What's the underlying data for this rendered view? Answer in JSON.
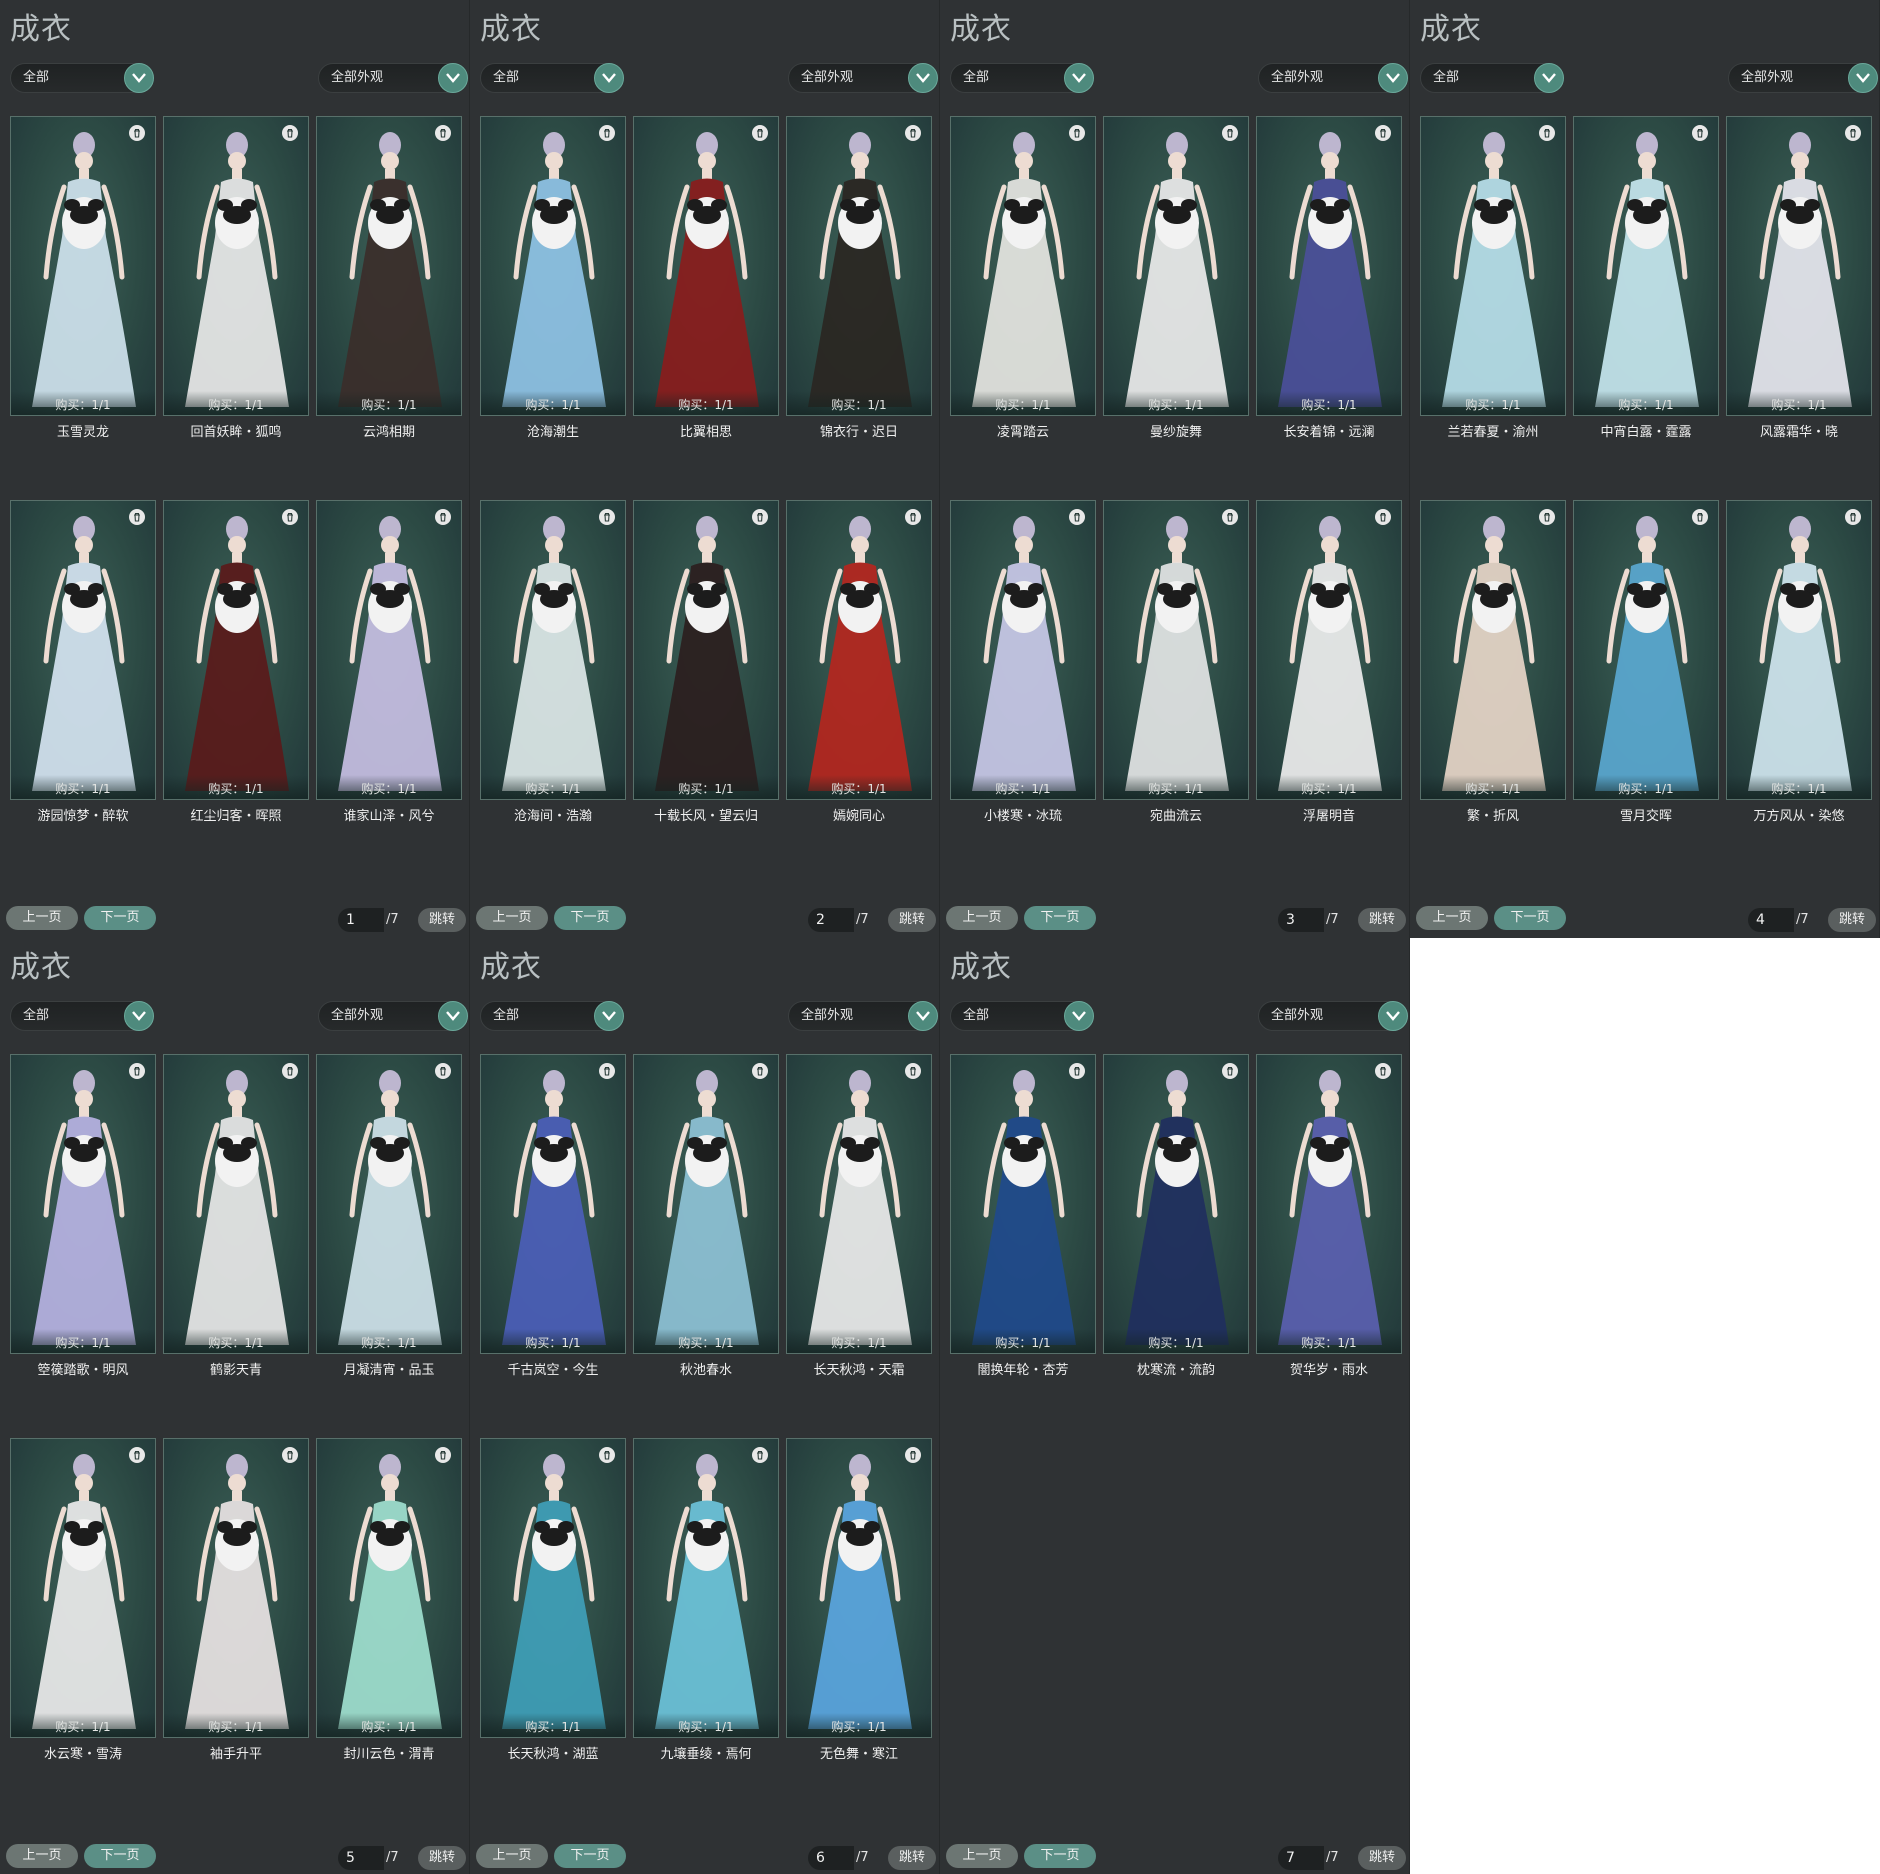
{
  "panels": [
    {
      "title": "成衣",
      "category": "全部",
      "appearance": "全部外观",
      "items": [
        {
          "name": "玉雪灵龙",
          "purchase": "购买：1/1",
          "color": "#cfe3ee"
        },
        {
          "name": "回首妖眸・狐鸣",
          "purchase": "购买：1/1",
          "color": "#e9e9e9"
        },
        {
          "name": "云鸿相期",
          "purchase": "购买：1/1",
          "color": "#3b2e2a"
        },
        {
          "name": "游园惊梦・醉软",
          "purchase": "购买：1/1",
          "color": "#d5e4f1"
        },
        {
          "name": "红尘归客・晖照",
          "purchase": "购买：1/1",
          "color": "#5a1a1a"
        },
        {
          "name": "谁家山泽・风兮",
          "purchase": "购买：1/1",
          "color": "#c7bfe3"
        }
      ],
      "prev": "上一页",
      "next": "下一页",
      "page": "1",
      "total": "/7",
      "jump": "跳转"
    },
    {
      "title": "成衣",
      "category": "全部",
      "appearance": "全部外观",
      "items": [
        {
          "name": "沧海潮生",
          "purchase": "购买：1/1",
          "color": "#8fc3e6"
        },
        {
          "name": "比翼相思",
          "purchase": "购买：1/1",
          "color": "#8a1c1c"
        },
        {
          "name": "锦衣行・迟日",
          "purchase": "购买：1/1",
          "color": "#2a2622"
        },
        {
          "name": "沧海间・浩瀚",
          "purchase": "购买：1/1",
          "color": "#dde8e8"
        },
        {
          "name": "十载长风・望云归",
          "purchase": "购买：1/1",
          "color": "#2b1e1e"
        },
        {
          "name": "嫣婉同心",
          "purchase": "购买：1/1",
          "color": "#b5261e"
        }
      ],
      "prev": "上一页",
      "next": "下一页",
      "page": "2",
      "total": "/7",
      "jump": "跳转"
    },
    {
      "title": "成衣",
      "category": "全部",
      "appearance": "全部外观",
      "items": [
        {
          "name": "凌霄踏云",
          "purchase": "购买：1/1",
          "color": "#e6e6e2"
        },
        {
          "name": "曼纱旋舞",
          "purchase": "购买：1/1",
          "color": "#ececec"
        },
        {
          "name": "长安着锦・远澜",
          "purchase": "购买：1/1",
          "color": "#4b4f9a"
        },
        {
          "name": "小楼寒・冰琉",
          "purchase": "购买：1/1",
          "color": "#c9c9e8"
        },
        {
          "name": "宛曲流云",
          "purchase": "购买：1/1",
          "color": "#e3e5e5"
        },
        {
          "name": "浮屠明音",
          "purchase": "购买：1/1",
          "color": "#eeeeee"
        }
      ],
      "prev": "上一页",
      "next": "下一页",
      "page": "3",
      "total": "/7",
      "jump": "跳转"
    },
    {
      "title": "成衣",
      "category": "全部",
      "appearance": "全部外观",
      "items": [
        {
          "name": "兰若春夏・渝州",
          "purchase": "购买：1/1",
          "color": "#b9e0ea"
        },
        {
          "name": "中宵白露・霆露",
          "purchase": "购买：1/1",
          "color": "#c6e6ee"
        },
        {
          "name": "风露霜华・晓",
          "purchase": "购买：1/1",
          "color": "#e7e7ef"
        },
        {
          "name": "繁・折风",
          "purchase": "购买：1/1",
          "color": "#e7d6c8"
        },
        {
          "name": "雪月交晖",
          "purchase": "购买：1/1",
          "color": "#5aa8d0"
        },
        {
          "name": "万方风从・染悠",
          "purchase": "购买：1/1",
          "color": "#d0e6ef"
        }
      ],
      "prev": "上一页",
      "next": "下一页",
      "page": "4",
      "total": "/7",
      "jump": "跳转"
    },
    {
      "title": "成衣",
      "category": "全部",
      "appearance": "全部外观",
      "items": [
        {
          "name": "箜篌踏歌・明风",
          "purchase": "购买：1/1",
          "color": "#b7b3e3"
        },
        {
          "name": "鹤影天青",
          "purchase": "购买：1/1",
          "color": "#e8e8e8"
        },
        {
          "name": "月凝清宵・品玉",
          "purchase": "购买：1/1",
          "color": "#cfe3ea"
        },
        {
          "name": "水云寒・雪涛",
          "purchase": "购买：1/1",
          "color": "#ececec"
        },
        {
          "name": "袖手升平",
          "purchase": "购买：1/1",
          "color": "#e9e4e4"
        },
        {
          "name": "封川云色・渭青",
          "purchase": "购买：1/1",
          "color": "#9fe0cf"
        }
      ],
      "prev": "上一页",
      "next": "下一页",
      "page": "5",
      "total": "/7",
      "jump": "跳转"
    },
    {
      "title": "成衣",
      "category": "全部",
      "appearance": "全部外观",
      "items": [
        {
          "name": "千古岚空・今生",
          "purchase": "购买：1/1",
          "color": "#4b5eb8"
        },
        {
          "name": "秋池春水",
          "purchase": "购买：1/1",
          "color": "#8ec2d6"
        },
        {
          "name": "长天秋鸿・天霜",
          "purchase": "购买：1/1",
          "color": "#ececec"
        },
        {
          "name": "长天秋鸿・湖蓝",
          "purchase": "购买：1/1",
          "color": "#3f9fb8"
        },
        {
          "name": "九壤垂绫・焉何",
          "purchase": "购买：1/1",
          "color": "#6cc3da"
        },
        {
          "name": "无色舞・寒江",
          "purchase": "购买：1/1",
          "color": "#5aa6e0"
        }
      ],
      "prev": "上一页",
      "next": "下一页",
      "page": "6",
      "total": "/7",
      "jump": "跳转"
    },
    {
      "title": "成衣",
      "category": "全部",
      "appearance": "全部外观",
      "items": [
        {
          "name": "闇换年轮・杏芳",
          "purchase": "购买：1/1",
          "color": "#1f4a8c"
        },
        {
          "name": "枕寒流・流韵",
          "purchase": "购买：1/1",
          "color": "#1f2f5e"
        },
        {
          "name": "贺华岁・雨水",
          "purchase": "购买：1/1",
          "color": "#5a5fb0"
        }
      ],
      "prev": "上一页",
      "next": "下一页",
      "page": "7",
      "total": "/7",
      "jump": "跳转"
    }
  ],
  "colors": {
    "panel_bg": "#2f3234",
    "card_bg": "#2c4a44",
    "accent": "#5b8f86"
  },
  "icons": {
    "card_corner": "trash-icon",
    "dropdown": "chevron-down-icon"
  }
}
